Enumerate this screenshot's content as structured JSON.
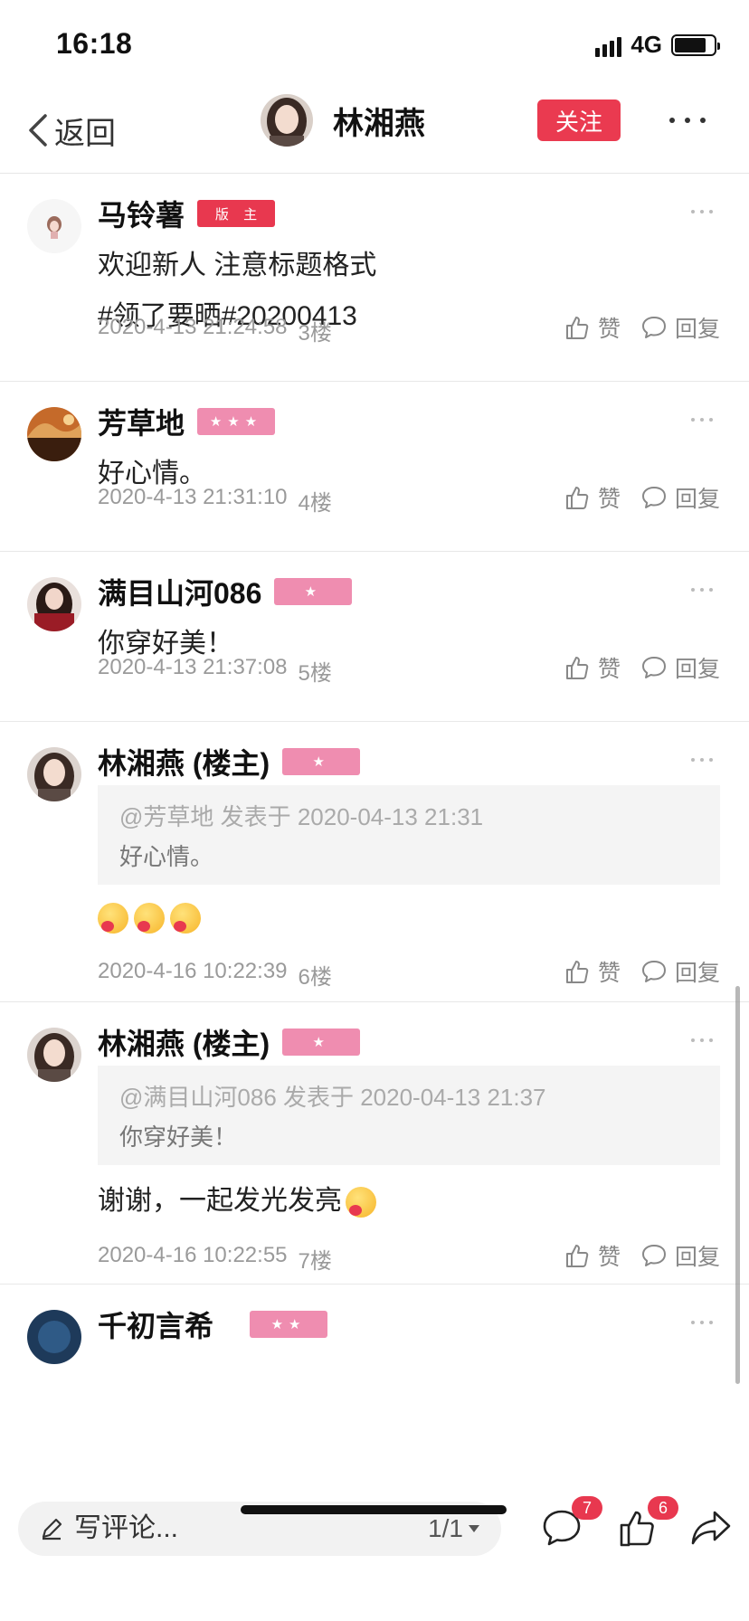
{
  "status": {
    "time": "16:18",
    "network": "4G"
  },
  "nav": {
    "back_label": "返回",
    "user_name": "林湘燕",
    "follow_label": "关注"
  },
  "comments": [
    {
      "name": "马铃薯",
      "badge": "版 主",
      "text": "欢迎新人 注意标题格式\n#领了要晒#20200413",
      "time": "2020-4-13 21:24:58",
      "floor": "3楼"
    },
    {
      "name": "芳草地",
      "badge_stars": "★★★",
      "text": "好心情。",
      "time": "2020-4-13 21:31:10",
      "floor": "4楼"
    },
    {
      "name": "满目山河086",
      "badge_stars": "★",
      "text": "你穿好美！",
      "time": "2020-4-13 21:37:08",
      "floor": "5楼"
    },
    {
      "name": "林湘燕 (楼主)",
      "badge_stars": "★",
      "quote_meta": "@芳草地 发表于 2020-04-13 21:31",
      "quote_text": "好心情。",
      "time": "2020-4-16 10:22:39",
      "floor": "6楼"
    },
    {
      "name": "林湘燕 (楼主)",
      "badge_stars": "★",
      "quote_meta": "@满目山河086 发表于 2020-04-13 21:37",
      "quote_text": "你穿好美！",
      "text": "谢谢，一起发光发亮",
      "time": "2020-4-16 10:22:55",
      "floor": "7楼"
    },
    {
      "name": "千初言希",
      "badge_stars": "★★"
    }
  ],
  "actions": {
    "like_label": "赞",
    "reply_label": "回复"
  },
  "bottom": {
    "placeholder": "写评论...",
    "page": "1/1",
    "comment_count": "7",
    "like_count": "6"
  },
  "colors": {
    "accent": "#ea3a50",
    "star_badge": "#ef8db0"
  }
}
